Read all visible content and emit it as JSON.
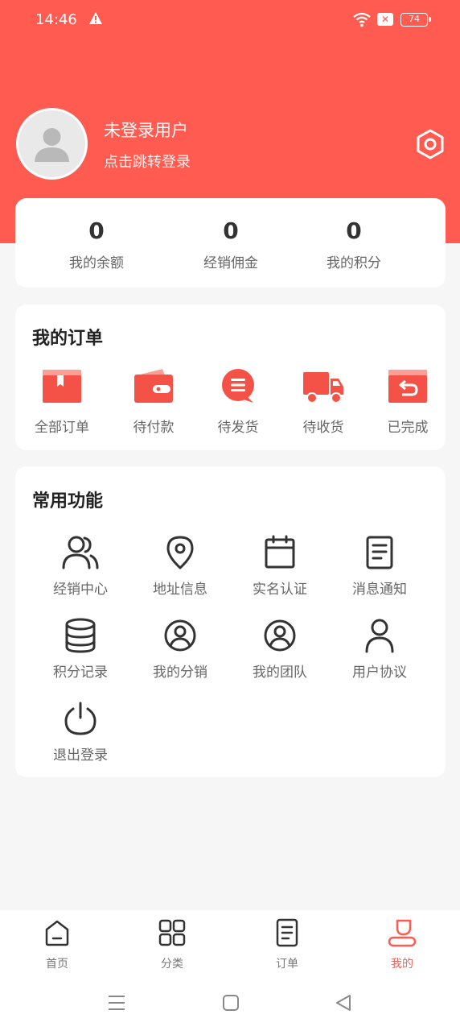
{
  "status_bar": {
    "time": "14:46",
    "battery": "74",
    "icons": [
      "warning-icon",
      "wifi-icon",
      "sim-off-icon",
      "battery-icon"
    ]
  },
  "profile": {
    "name": "未登录用户",
    "subtitle": "点击跳转登录"
  },
  "stats": [
    {
      "value": "0",
      "label": "我的余额"
    },
    {
      "value": "0",
      "label": "经销佣金"
    },
    {
      "value": "0",
      "label": "我的积分"
    }
  ],
  "orders": {
    "title": "我的订单",
    "items": [
      {
        "label": "全部订单",
        "icon": "box-icon"
      },
      {
        "label": "待付款",
        "icon": "wallet-icon"
      },
      {
        "label": "待发货",
        "icon": "message-icon"
      },
      {
        "label": "待收货",
        "icon": "truck-icon"
      },
      {
        "label": "已完成",
        "icon": "return-box-icon"
      }
    ]
  },
  "functions": {
    "title": "常用功能",
    "items": [
      {
        "label": "经销中心",
        "icon": "users-icon"
      },
      {
        "label": "地址信息",
        "icon": "location-icon"
      },
      {
        "label": "实名认证",
        "icon": "calendar-icon"
      },
      {
        "label": "消息通知",
        "icon": "document-icon"
      },
      {
        "label": "积分记录",
        "icon": "coins-icon"
      },
      {
        "label": "我的分销",
        "icon": "user-circle-icon"
      },
      {
        "label": "我的团队",
        "icon": "team-circle-icon"
      },
      {
        "label": "用户协议",
        "icon": "user-icon"
      },
      {
        "label": "退出登录",
        "icon": "power-icon"
      }
    ]
  },
  "tabbar": {
    "items": [
      {
        "label": "首页",
        "icon": "home-icon",
        "active": false
      },
      {
        "label": "分类",
        "icon": "grid-icon",
        "active": false
      },
      {
        "label": "订单",
        "icon": "order-icon",
        "active": false
      },
      {
        "label": "我的",
        "icon": "profile-icon",
        "active": true
      }
    ]
  },
  "colors": {
    "accent": "#ff5b50",
    "background": "#f6f6f6"
  }
}
